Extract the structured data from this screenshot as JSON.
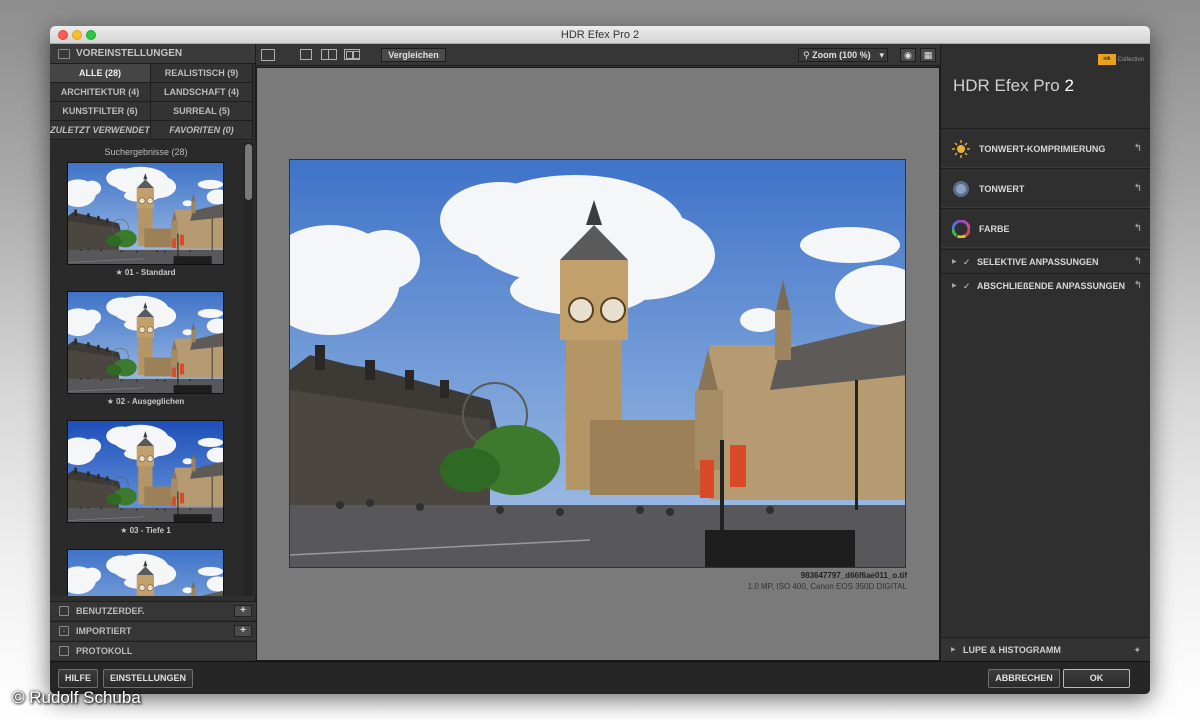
{
  "window": {
    "title": "HDR Efex Pro 2"
  },
  "left": {
    "header": "VOREINSTELLUNGEN",
    "filters": [
      {
        "label": "ALLE (28)",
        "selected": true,
        "italic": false
      },
      {
        "label": "REALISTISCH (9)",
        "selected": false,
        "italic": false
      },
      {
        "label": "ARCHITEKTUR (4)",
        "selected": false,
        "italic": false
      },
      {
        "label": "LANDSCHAFT (4)",
        "selected": false,
        "italic": false
      },
      {
        "label": "KUNSTFILTER (6)",
        "selected": false,
        "italic": false
      },
      {
        "label": "SURREAL (5)",
        "selected": false,
        "italic": false
      },
      {
        "label": "ZULETZT VERWENDET",
        "selected": false,
        "italic": true
      },
      {
        "label": "FAVORITEN (0)",
        "selected": false,
        "italic": true
      }
    ],
    "search_results": "Suchergebnisse (28)",
    "presets": [
      {
        "label": "★ 01 - Standard"
      },
      {
        "label": "★ 02 - Ausgeglichen"
      },
      {
        "label": "★ 03 - Tiefe 1"
      },
      {
        "label": ""
      }
    ],
    "sections": [
      "BENUTZERDEF.",
      "IMPORTIERT",
      "PROTOKOLL"
    ]
  },
  "toolbar": {
    "compare_label": "Vergleichen",
    "zoom_label": "Zoom (100 %)"
  },
  "canvas": {
    "filename": "983647797_d66f6ae011_o.tif",
    "info": "1.0 MP, ISO 400, Canon EOS 350D DIGITAL"
  },
  "right": {
    "brand_text": "Collection",
    "brand_logo": "nik",
    "title": "HDR Efex Pro",
    "title_version": "2",
    "sections": [
      {
        "label": "TONWERT-KOMPRIMIERUNG",
        "icon": "sun-icon"
      },
      {
        "label": "TONWERT",
        "icon": "tone-icon"
      },
      {
        "label": "FARBE",
        "icon": "color-wheel-icon"
      }
    ],
    "subsections": [
      "SELEKTIVE ANPASSUNGEN",
      "ABSCHLIEßENDE ANPASSUNGEN"
    ],
    "bottom": "LUPE & HISTOGRAMM"
  },
  "bottom": {
    "help": "HILFE",
    "settings": "EINSTELLUNGEN",
    "cancel": "ABBRECHEN",
    "ok": "OK"
  },
  "credit": "© Rudolf Schuba",
  "colors": {
    "panel": "#2f2f2f",
    "canvas": "#7a7a7a",
    "accent": "#e8a21c"
  }
}
